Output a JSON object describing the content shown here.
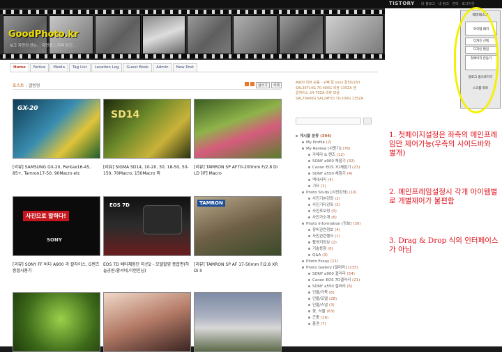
{
  "top_bar": {
    "brand": "TISTORY",
    "links": [
      "내 블로그",
      "내 링크",
      "관리",
      "로그아웃"
    ]
  },
  "blog": {
    "title": "GoodPhoto.kr",
    "tagline": "보고 자연의 찬는... 자연을 느끼며 담긴..."
  },
  "nav": {
    "tabs": [
      "Home",
      "Notice",
      "Media",
      "Tag List",
      "Location Log",
      "Guest Book",
      "Admin",
      "New Post"
    ],
    "active_index": 0
  },
  "post_header": {
    "label": "포스트",
    "category": "앨범형",
    "buttons": [
      "글쓰기",
      "삭제"
    ]
  },
  "posts": [
    {
      "title": "[리뷰] SAMSUNG GX-20, Pentax16-45, 85+, Tamron17-50, 90Macro etc",
      "thumb_color": "#2e6d8a"
    },
    {
      "title": "[리뷰] SIGMA SD14, 10-20, 30, 18-50, 50-150, 70Macro, 150Macro 외",
      "thumb_color": "#3f4a1e"
    },
    {
      "title": "[리뷰] TAMRON SP AF70-200mm F/2.8 Di LD [IF] Macro",
      "thumb_color": "#6f8f3c"
    },
    {
      "title": "[리뷰] SONY FF 바디 A900 과 칼자이스, G렌즈 종합사용기",
      "thumb_color": "#111111"
    },
    {
      "title": "EOS 7D 베타체험단 미션2 - 모델촬영 종합편(하늘공원:황서네,이현진님)",
      "thumb_color": "#1c1c1c"
    },
    {
      "title": "[리뷰] TAMRON SP AF 17-50mm F/2.8 XR Di II",
      "thumb_color": "#7a6b4d"
    },
    {
      "title": "",
      "thumb_color": "#4e7a22"
    },
    {
      "title": "",
      "thumb_color": "#caa999"
    },
    {
      "title": "",
      "thumb_color": "#8a8fa3"
    }
  ],
  "thumb_texts": {
    "gx": "GX-20",
    "sd14": "SD14",
    "sony_banner": "사진으로 말하다!",
    "sony": "SONY",
    "eos": "EOS 7D",
    "tamron": "TAMRON"
  },
  "sidebar_top": {
    "lines": [
      "A900 리뷰 모음 - 구팩 칼 sony 칼50/160",
      "SAL35F14G 70-400G 리뷰 135ZA 렌",
      "칼자이스 24-70ZA 리뷰 모음",
      "SAL70400G SAL24F20 70-200G 135ZA"
    ]
  },
  "sidebar_categories": [
    {
      "name": "게시물 분류",
      "count": "(394)",
      "level": 0
    },
    {
      "name": "My Profile",
      "count": "(2)",
      "level": 1
    },
    {
      "name": "My Review [사용기]",
      "count": "(76)",
      "level": 1
    },
    {
      "name": "카메라 & 렌즈",
      "count": "(12)",
      "level": 2
    },
    {
      "name": "SONY a900 체험기",
      "count": "(32)",
      "level": 2
    },
    {
      "name": "Canon EOS 7D체험기",
      "count": "(23)",
      "level": 2
    },
    {
      "name": "SONY a550 체험기",
      "count": "(4)",
      "level": 2
    },
    {
      "name": "액세서리",
      "count": "(4)",
      "level": 2
    },
    {
      "name": "기타",
      "count": "(1)",
      "level": 2
    },
    {
      "name": "Photo Study [사진강좌]",
      "count": "(10)",
      "level": 1
    },
    {
      "name": "사진기본강좌",
      "count": "(2)",
      "level": 2
    },
    {
      "name": "사진기타강좌",
      "count": "(2)",
      "level": 2
    },
    {
      "name": "사진후보정",
      "count": "(0)",
      "level": 2
    },
    {
      "name": "사진가소개",
      "count": "(6)",
      "level": 2
    },
    {
      "name": "Photo Information [정보]",
      "count": "(30)",
      "level": 1
    },
    {
      "name": "장비관련정보",
      "count": "(4)",
      "level": 2
    },
    {
      "name": "사진관련행사",
      "count": "(1)",
      "level": 2
    },
    {
      "name": "촬영지정보",
      "count": "(2)",
      "level": 2
    },
    {
      "name": "기술동향",
      "count": "(0)",
      "level": 2
    },
    {
      "name": "Q&A",
      "count": "(3)",
      "level": 2
    },
    {
      "name": "Photo Essay",
      "count": "(11)",
      "level": 1
    },
    {
      "name": "Photo Gallery [갤러리]",
      "count": "(235)",
      "level": 1
    },
    {
      "name": "SONY a900 갤러리",
      "count": "(54)",
      "level": 2
    },
    {
      "name": "Canon EOS 7D갤러리",
      "count": "(21)",
      "level": 2
    },
    {
      "name": "SONY a550 갤러리",
      "count": "(6)",
      "level": 2
    },
    {
      "name": "인물/가족",
      "count": "(6)",
      "level": 2
    },
    {
      "name": "인물/모델",
      "count": "(28)",
      "level": 2
    },
    {
      "name": "인물/스냅",
      "count": "(3)",
      "level": 2
    },
    {
      "name": "꽃, 식물",
      "count": "(63)",
      "level": 2
    },
    {
      "name": "곤충",
      "count": "(16)",
      "level": 2
    },
    {
      "name": "풍경",
      "count": "(7)",
      "level": 2
    }
  ],
  "tools_panel": {
    "title": "테마데스크",
    "buttons": [
      "아이템 배치",
      "디자인 선택",
      "디자인 편집",
      "첫페이지 만들기",
      "블로그 홈으로가기",
      "스크롤 따라"
    ]
  },
  "annotations": [
    "1. 첫페이지설정은 좌측의 메인프레임만 제어가능(우측의 사이드바와 별개)",
    "2. 메인프레임설정시 각개 아이템별로 개별제어가 불편함",
    "3. Drag & Drop 식의 인터페이스가 아님"
  ],
  "colors": {
    "accent_title": "#f0e000",
    "annotation": "#e0101a",
    "highlight_ellipse": "#f5f000",
    "link": "#3a4d7a"
  }
}
